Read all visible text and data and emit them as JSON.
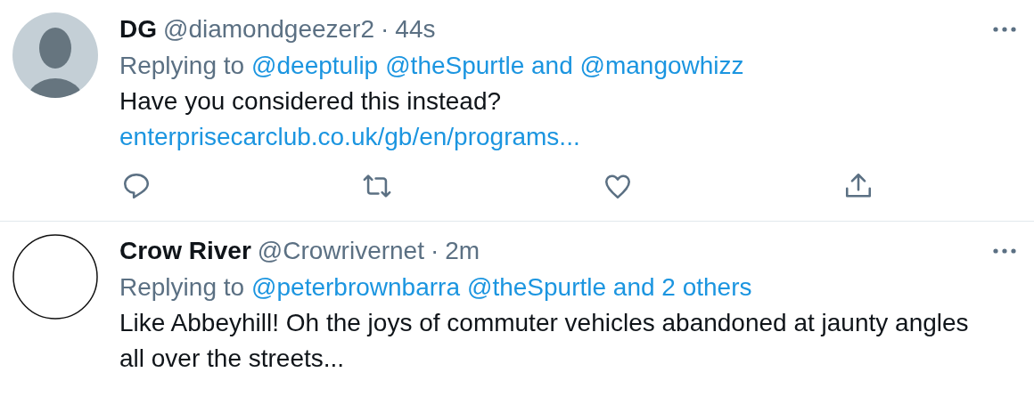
{
  "tweets": [
    {
      "avatar": {
        "kind": "default"
      },
      "name": "DG",
      "handle": "@diamondgeezer2",
      "separator": "·",
      "time": "44s",
      "replying": {
        "label": "Replying to",
        "links": [
          "@deeptulip",
          "@theSpurtle and @mangowhizz"
        ]
      },
      "text": "Have you considered this instead?",
      "link": "enterprisecarclub.co.uk/gb/en/programs...",
      "actions": true
    },
    {
      "avatar": {
        "kind": "blank"
      },
      "name": "Crow River",
      "handle": "@Crowrivernet",
      "separator": "·",
      "time": "2m",
      "replying": {
        "label": "Replying to",
        "links": [
          "@peterbrownbarra",
          "@theSpurtle and 2 others"
        ]
      },
      "text": "Like Abbeyhill! Oh the joys of commuter vehicles abandoned at jaunty angles all over the streets...",
      "actions": false
    }
  ]
}
